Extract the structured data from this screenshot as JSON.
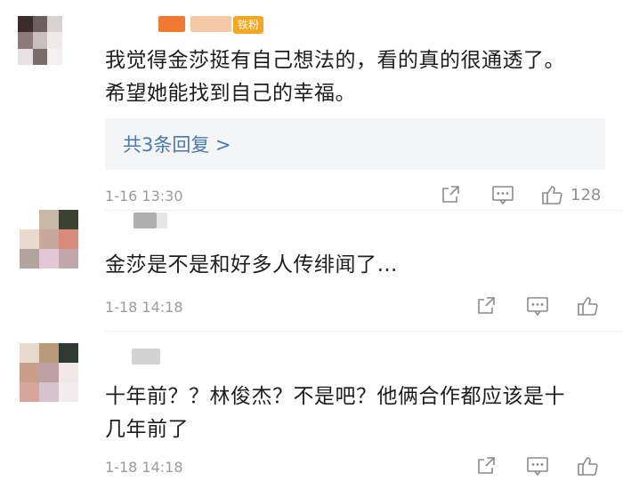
{
  "comments": [
    {
      "text": "我觉得金莎挺有自己想法的，看的真的很通透了。希望她能找到自己的幸福。",
      "badge": "铁粉",
      "replies_link": "共3条回复 >",
      "time": "1-16 13:30",
      "likes": "128"
    },
    {
      "text": "金莎是不是和好多人传绯闻了…",
      "time": "1-18 14:18",
      "likes": ""
    },
    {
      "text": "十年前？？林俊杰？不是吧？他俩合作都应该是十几年前了",
      "time": "1-18 14:18",
      "likes": ""
    }
  ],
  "icons": {
    "share": "share-icon",
    "reply": "comment-icon",
    "like": "thumbs-up-icon"
  },
  "colors": {
    "link": "#4a78b5",
    "meta": "#9a9a9a",
    "reply_box_bg": "#f4f5f7",
    "badge": "#f5a623"
  }
}
